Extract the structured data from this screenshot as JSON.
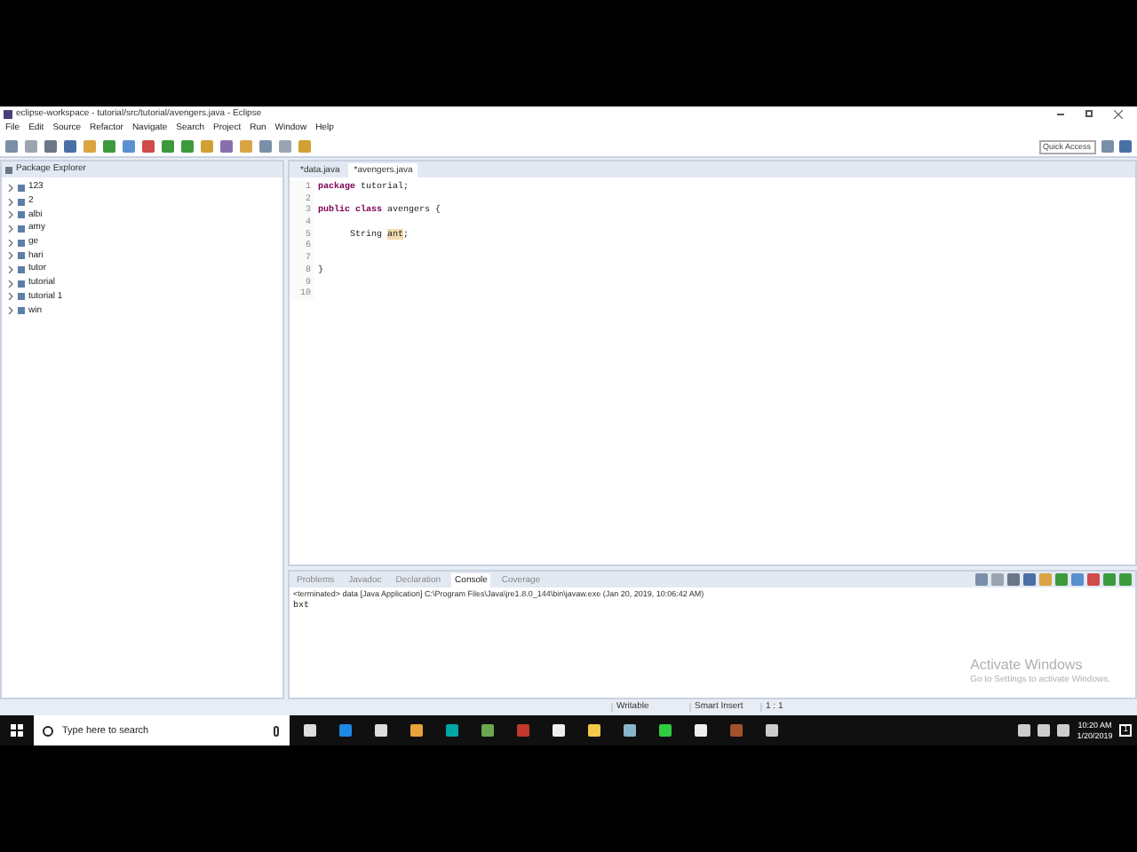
{
  "window": {
    "title": "eclipse-workspace - tutorial/src/tutorial/avengers.java - Eclipse"
  },
  "menu": [
    "File",
    "Edit",
    "Source",
    "Refactor",
    "Navigate",
    "Search",
    "Project",
    "Run",
    "Window",
    "Help"
  ],
  "quick_access": {
    "placeholder": "Quick Access"
  },
  "package_explorer": {
    "title": "Package Explorer",
    "items": [
      {
        "label": "123",
        "expanded": false
      },
      {
        "label": "2",
        "expanded": false
      },
      {
        "label": "albi",
        "expanded": false
      },
      {
        "label": "amy",
        "expanded": false
      },
      {
        "label": "ge",
        "expanded": false
      },
      {
        "label": "hari",
        "expanded": false
      },
      {
        "label": "tutor",
        "expanded": false
      },
      {
        "label": "tutorial",
        "expanded": false
      },
      {
        "label": "tutorial 1",
        "expanded": false
      },
      {
        "label": "win",
        "expanded": false
      }
    ]
  },
  "editor_tabs": [
    {
      "label": "*data.java",
      "selected": false
    },
    {
      "label": "*avengers.java",
      "selected": true
    }
  ],
  "code_lines": [
    {
      "number": "1",
      "tokens": [
        {
          "kind": "keyword",
          "text": "package"
        },
        {
          "kind": "plain",
          "text": " tutorial;"
        }
      ]
    },
    {
      "number": "2"
    },
    {
      "number": "3",
      "tokens": [
        {
          "kind": "keyword",
          "text": "public class"
        },
        {
          "kind": "plain",
          "text": " avengers {"
        }
      ]
    },
    {
      "number": "4"
    },
    {
      "number": "5",
      "indented": true,
      "tokens": [
        {
          "kind": "plain",
          "text": "String "
        },
        {
          "kind": "highlight",
          "text": "ant"
        },
        {
          "kind": "plain",
          "text": ";"
        }
      ]
    },
    {
      "number": "6"
    },
    {
      "number": "7"
    },
    {
      "number": "8",
      "tokens": [
        {
          "kind": "plain",
          "text": "}"
        }
      ]
    },
    {
      "number": "9"
    },
    {
      "number": "10"
    }
  ],
  "bottom_tabs": [
    {
      "label": "Problems",
      "selected": false
    },
    {
      "label": "Javadoc",
      "selected": false
    },
    {
      "label": "Declaration",
      "selected": false
    },
    {
      "label": "Console",
      "selected": true
    },
    {
      "label": "Coverage",
      "selected": false
    }
  ],
  "console": {
    "header": "<terminated> data [Java Application] C:\\Program Files\\Java\\jre1.8.0_144\\bin\\javaw.exe (Jan 20, 2019, 10:06:42 AM)",
    "output": "bxt"
  },
  "activation": {
    "title": "Activate Windows",
    "subtitle": "Go to Settings to activate Windows."
  },
  "status_bar": [
    "Writable",
    "Smart Insert",
    "1 : 1"
  ],
  "taskbar": {
    "search": {
      "placeholder": "Type here to search"
    },
    "time": "10:20 AM",
    "date": "1/20/2019",
    "notifications": "1"
  }
}
